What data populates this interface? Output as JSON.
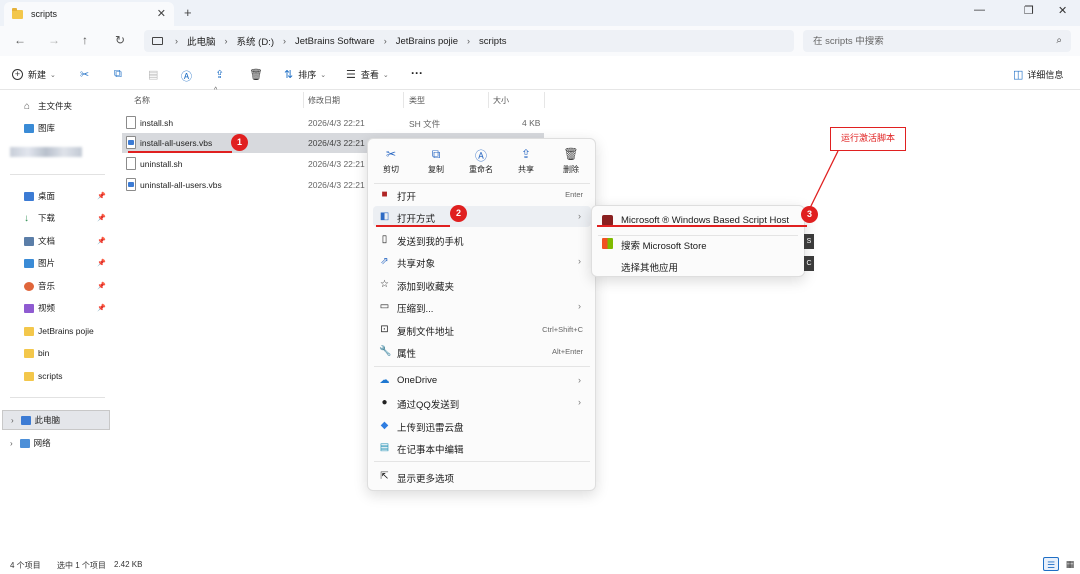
{
  "window": {
    "tab_title": "scripts",
    "new_tab": "+",
    "tab_close": "✕",
    "controls": {
      "minimize": "—",
      "maximize": "❐",
      "close": "✕"
    }
  },
  "nav": {
    "back": "←",
    "forward": "→",
    "up": "↑",
    "refresh": "↻"
  },
  "breadcrumb": [
    "此电脑",
    "系统 (D:)",
    "JetBrains Software",
    "JetBrains pojie",
    "scripts"
  ],
  "search": {
    "placeholder": "在 scripts 中搜索"
  },
  "toolbar": {
    "new_label": "新建",
    "sort_label": "排序",
    "view_label": "查看",
    "more": "···",
    "details_label": "详细信息"
  },
  "sidebar": {
    "top": [
      {
        "label": "主文件夹",
        "icon": "home-icon"
      },
      {
        "label": "图库",
        "icon": "gallery-icon"
      }
    ],
    "quick": [
      {
        "label": "桌面",
        "icon": "desktop-icon",
        "color": "#3c7bd4"
      },
      {
        "label": "下载",
        "icon": "download-icon",
        "color": "#2a8d4f"
      },
      {
        "label": "文档",
        "icon": "documents-icon",
        "color": "#5b7ea8"
      },
      {
        "label": "图片",
        "icon": "pictures-icon",
        "color": "#3a8bd6"
      },
      {
        "label": "音乐",
        "icon": "music-icon",
        "color": "#e0663b"
      },
      {
        "label": "视频",
        "icon": "videos-icon",
        "color": "#8f5bd1"
      },
      {
        "label": "JetBrains pojie",
        "icon": "folder-icon",
        "color": "#f3c74b"
      },
      {
        "label": "bin",
        "icon": "folder-icon",
        "color": "#f3c74b"
      },
      {
        "label": "scripts",
        "icon": "folder-icon",
        "color": "#f3c74b"
      }
    ],
    "this_pc": "此电脑",
    "network": "网络"
  },
  "filelist": {
    "columns": [
      "名称",
      "修改日期",
      "类型",
      "大小"
    ],
    "rows": [
      {
        "name": "install.sh",
        "date": "2026/4/3 22:21",
        "type": "SH 文件",
        "size": "4 KB",
        "icon": "file-icon"
      },
      {
        "name": "install-all-users.vbs",
        "date": "2026/4/3 22:21",
        "type": "",
        "size": "",
        "icon": "vbs-file-icon"
      },
      {
        "name": "uninstall.sh",
        "date": "2026/4/3 22:21",
        "type": "",
        "size": "",
        "icon": "file-icon"
      },
      {
        "name": "uninstall-all-users.vbs",
        "date": "2026/4/3 22:21",
        "type": "",
        "size": "",
        "icon": "vbs-file-icon"
      }
    ]
  },
  "context_menu": {
    "quick_actions": [
      {
        "label": "剪切",
        "icon": "✂"
      },
      {
        "label": "复制",
        "icon": "⧉"
      },
      {
        "label": "重命名",
        "icon": "Ⓐ"
      },
      {
        "label": "共享",
        "icon": "⇪"
      },
      {
        "label": "删除",
        "icon": "🗑"
      }
    ],
    "items": [
      {
        "label": "打开",
        "shortcut": "Enter",
        "icon": "■"
      },
      {
        "label": "打开方式",
        "icon": "◧"
      },
      {
        "label": "发送到我的手机",
        "icon": "▯"
      },
      {
        "label": "共享对象",
        "icon": "⇗"
      },
      {
        "label": "添加到收藏夹",
        "icon": "☆"
      },
      {
        "label": "压缩到...",
        "icon": "▭"
      },
      {
        "label": "复制文件地址",
        "shortcut": "Ctrl+Shift+C",
        "icon": "⊡"
      },
      {
        "label": "属性",
        "shortcut": "Alt+Enter",
        "icon": "🔧"
      },
      {
        "label": "OneDrive",
        "icon": "☁"
      },
      {
        "label": "通过QQ发送到",
        "icon": "●"
      },
      {
        "label": "上传到迅雷云盘",
        "icon": "◆"
      },
      {
        "label": "在记事本中编辑",
        "icon": "▤"
      },
      {
        "label": "显示更多选项",
        "icon": "⇱"
      }
    ],
    "arrow": "›"
  },
  "submenu": {
    "items": [
      {
        "label": "Microsoft ® Windows Based Script Host",
        "icon": "script-host-icon"
      },
      {
        "label": "搜索 Microsoft Store",
        "icon": "store-icon"
      },
      {
        "label": "选择其他应用"
      }
    ],
    "cut_letters": [
      "S",
      "C"
    ]
  },
  "annotations": {
    "badges": [
      "1",
      "2",
      "3"
    ],
    "callout": "运行激活脚本",
    "color": "#e02020"
  },
  "status": {
    "count": "4 个项目",
    "selection": "选中 1 个项目",
    "size": "2.42 KB"
  },
  "colors": {
    "accent": "#1f6fc5",
    "folder": "#f3c74b",
    "selected_row": "#d7d9dd"
  }
}
